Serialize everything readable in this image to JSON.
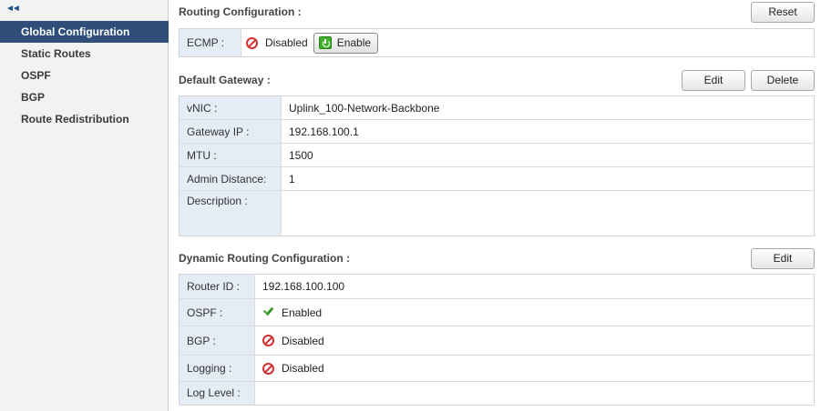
{
  "sidebar": {
    "collapse_glyph": "◄◄",
    "items": [
      {
        "label": "Global Configuration"
      },
      {
        "label": "Static Routes"
      },
      {
        "label": "OSPF"
      },
      {
        "label": "BGP"
      },
      {
        "label": "Route Redistribution"
      }
    ]
  },
  "routing_config": {
    "title": "Routing Configuration :",
    "reset_label": "Reset",
    "ecmp_label": "ECMP :",
    "ecmp_status": "Disabled",
    "enable_label": "Enable"
  },
  "default_gateway": {
    "title": "Default Gateway :",
    "edit_label": "Edit",
    "delete_label": "Delete",
    "rows": [
      {
        "label": "vNIC :",
        "value": "Uplink_100-Network-Backbone"
      },
      {
        "label": "Gateway IP :",
        "value": "192.168.100.1"
      },
      {
        "label": "MTU :",
        "value": "1500"
      },
      {
        "label": "Admin Distance:",
        "value": "1"
      },
      {
        "label": "Description :",
        "value": ""
      }
    ]
  },
  "dynamic_routing": {
    "title": "Dynamic Routing Configuration :",
    "edit_label": "Edit",
    "router_id_label": "Router ID :",
    "router_id": "192.168.100.100",
    "ospf_label": "OSPF :",
    "ospf_status": "Enabled",
    "bgp_label": "BGP :",
    "bgp_status": "Disabled",
    "logging_label": "Logging :",
    "logging_status": "Disabled",
    "log_level_label": "Log Level :",
    "log_level": ""
  },
  "colors": {
    "sidebar_active": "#2f4f7a",
    "label_bg": "#e4ecf5",
    "disabled_red": "#d23232",
    "enabled_green": "#3a9a2a"
  }
}
